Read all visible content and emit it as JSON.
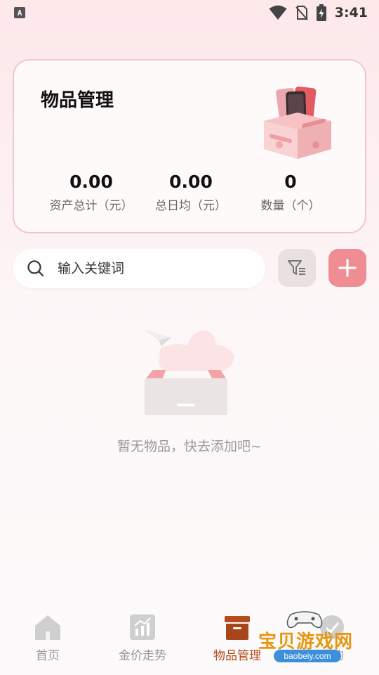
{
  "status_bar": {
    "app_indicator": "A",
    "time": "3:41",
    "icons": [
      "wifi-icon",
      "sim-off-icon",
      "battery-charging-icon"
    ]
  },
  "summary_card": {
    "title": "物品管理",
    "illustration": "storage-box-illustration",
    "stats": [
      {
        "value": "0.00",
        "label": "资产总计（元）"
      },
      {
        "value": "0.00",
        "label": "总日均（元）"
      },
      {
        "value": "0",
        "label": "数量（个）"
      }
    ]
  },
  "search": {
    "placeholder": "输入关键词",
    "value": "",
    "icon": "search-icon"
  },
  "toolbar": {
    "filter_icon": "filter-icon",
    "add_icon": "plus-icon",
    "add_color": "#ef8d92"
  },
  "empty_state": {
    "text": "暂无物品，快去添加吧~",
    "illustration": "empty-box-illustration"
  },
  "bottom_nav": {
    "items": [
      {
        "label": "首页",
        "icon": "home-icon",
        "active": false
      },
      {
        "label": "金价走势",
        "icon": "chart-icon",
        "active": false
      },
      {
        "label": "物品管理",
        "icon": "archive-box-icon",
        "active": true
      },
      {
        "label": "我的",
        "icon": "profile-icon",
        "active": false
      }
    ],
    "active_color": "#b54a1c"
  },
  "watermark": {
    "title": "宝贝游戏网",
    "url": "baobeiy.com"
  }
}
